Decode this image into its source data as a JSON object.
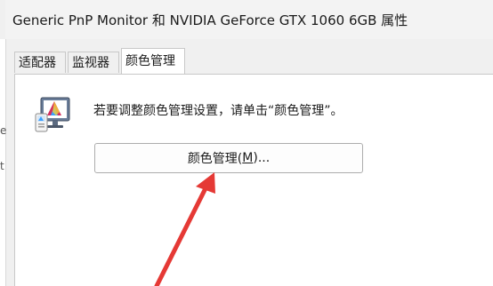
{
  "window": {
    "title": "Generic PnP Monitor 和 NVIDIA GeForce GTX 1060 6GB 属性"
  },
  "tabs": [
    {
      "label": "适配器"
    },
    {
      "label": "监视器"
    },
    {
      "label": "颜色管理"
    }
  ],
  "panel": {
    "icon": "monitor-color-icon",
    "description": "若要调整颜色管理设置，请单击“颜色管理”。",
    "button": {
      "label_pre": "颜色管理(",
      "label_key": "M",
      "label_post": ")..."
    }
  },
  "annotation": {
    "arrow_color": "#e53935"
  }
}
